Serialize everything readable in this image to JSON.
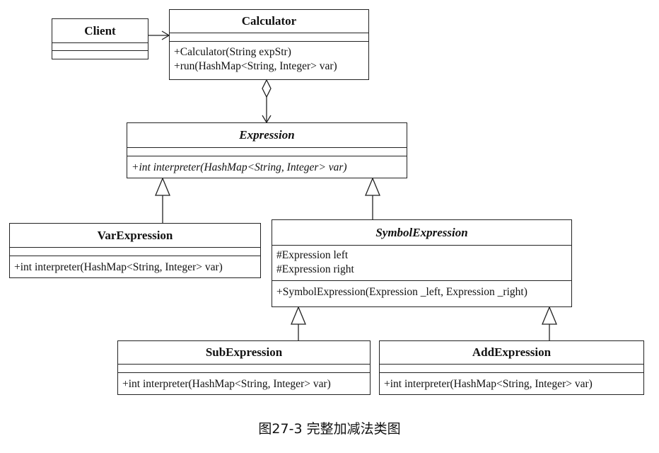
{
  "classes": {
    "client": {
      "name": "Client",
      "attributes": [],
      "operations": []
    },
    "calculator": {
      "name": "Calculator",
      "attributes": [],
      "operations": [
        "+Calculator(String expStr)",
        "+run(HashMap<String, Integer> var)"
      ]
    },
    "expression": {
      "name": "Expression",
      "abstract": true,
      "attributes": [],
      "operations": [
        "+int interpreter(HashMap<String, Integer> var)"
      ]
    },
    "var_expression": {
      "name": "VarExpression",
      "attributes": [],
      "operations": [
        "+int interpreter(HashMap<String, Integer> var)"
      ]
    },
    "symbol_expression": {
      "name": "SymbolExpression",
      "abstract": true,
      "attributes": [
        "#Expression left",
        "#Expression right"
      ],
      "operations": [
        "+SymbolExpression(Expression _left, Expression _right)"
      ]
    },
    "sub_expression": {
      "name": "SubExpression",
      "attributes": [],
      "operations": [
        "+int interpreter(HashMap<String, Integer> var)"
      ]
    },
    "add_expression": {
      "name": "AddExpression",
      "attributes": [],
      "operations": [
        "+int interpreter(HashMap<String, Integer> var)"
      ]
    }
  },
  "relations": [
    {
      "type": "association",
      "from": "Client",
      "to": "Calculator"
    },
    {
      "type": "aggregation",
      "from": "Calculator",
      "to": "Expression"
    },
    {
      "type": "generalization",
      "from": "VarExpression",
      "to": "Expression"
    },
    {
      "type": "generalization",
      "from": "SymbolExpression",
      "to": "Expression"
    },
    {
      "type": "generalization",
      "from": "SubExpression",
      "to": "SymbolExpression"
    },
    {
      "type": "generalization",
      "from": "AddExpression",
      "to": "SymbolExpression"
    }
  ],
  "caption": "图27-3 完整加减法类图"
}
